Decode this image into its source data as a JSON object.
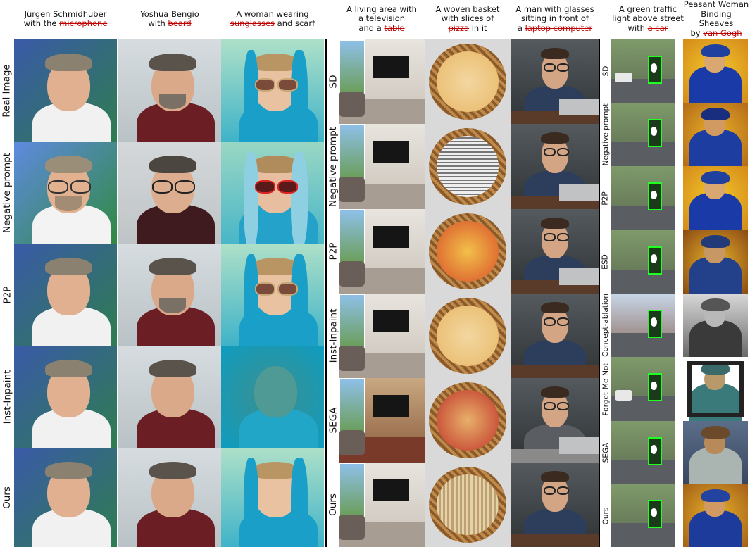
{
  "panels": [
    {
      "id": "faces",
      "columns": [
        {
          "parts": [
            {
              "text": "Jürgen Schmidhuber",
              "s": false
            },
            {
              "text": "\n"
            },
            {
              "text": "with the ",
              "s": false
            },
            {
              "text": "microphone",
              "s": true
            }
          ]
        },
        {
          "parts": [
            {
              "text": "Yoshua Bengio",
              "s": false
            },
            {
              "text": "\n"
            },
            {
              "text": "with ",
              "s": false
            },
            {
              "text": "beard",
              "s": true
            }
          ]
        },
        {
          "parts": [
            {
              "text": "A woman wearing",
              "s": false
            },
            {
              "text": "\n"
            },
            {
              "text": "sunglasses",
              "s": true
            },
            {
              "text": " and scarf",
              "s": false
            }
          ]
        }
      ],
      "rows": [
        "Real image",
        "Negative prompt",
        "P2P",
        "Inst-Inpaint",
        "Ours"
      ]
    },
    {
      "id": "scenes",
      "columns": [
        {
          "parts": [
            {
              "text": "A living area with",
              "s": false
            },
            {
              "text": "\n"
            },
            {
              "text": "a television",
              "s": false
            },
            {
              "text": "\n"
            },
            {
              "text": "and a ",
              "s": false
            },
            {
              "text": "table",
              "s": true
            }
          ]
        },
        {
          "parts": [
            {
              "text": "A woven basket",
              "s": false
            },
            {
              "text": "\n"
            },
            {
              "text": "with slices of",
              "s": false
            },
            {
              "text": "\n"
            },
            {
              "text": "pizza",
              "s": true
            },
            {
              "text": " in it",
              "s": false
            }
          ]
        },
        {
          "parts": [
            {
              "text": "A man with glasses",
              "s": false
            },
            {
              "text": "\n"
            },
            {
              "text": "sitting in front of",
              "s": false
            },
            {
              "text": "\n"
            },
            {
              "text": "a ",
              "s": false
            },
            {
              "text": "laptop computer",
              "s": true
            }
          ]
        }
      ],
      "rows": [
        "SD",
        "Negative prompt",
        "P2P",
        "Inst-Inpaint",
        "SEGA",
        "Ours"
      ]
    },
    {
      "id": "art",
      "columns": [
        {
          "parts": [
            {
              "text": "A green traffic",
              "s": false
            },
            {
              "text": "\n"
            },
            {
              "text": "light above street",
              "s": false
            },
            {
              "text": "\n"
            },
            {
              "text": "with ",
              "s": false
            },
            {
              "text": "a car",
              "s": true
            }
          ]
        },
        {
          "parts": [
            {
              "text": "Peasant Woman",
              "s": false
            },
            {
              "text": "\n"
            },
            {
              "text": "Binding Sheaves",
              "s": false
            },
            {
              "text": "\n"
            },
            {
              "text": "by ",
              "s": false
            },
            {
              "text": "van Gogh",
              "s": true
            }
          ]
        }
      ],
      "rows": [
        "SD",
        "Negative prompt",
        "P2P",
        "ESD",
        "Concept-ablation",
        "Forget-Me-Not",
        "SEGA",
        "Ours"
      ]
    }
  ],
  "colors": {
    "strike": "#c00000",
    "divider": "#000000"
  }
}
